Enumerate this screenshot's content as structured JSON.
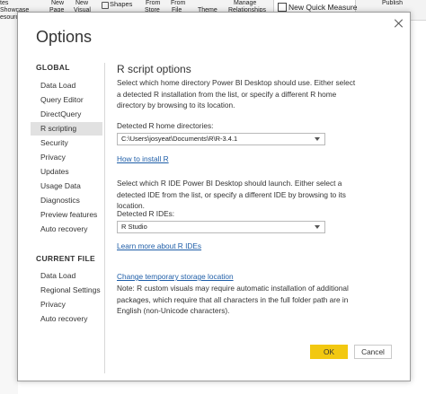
{
  "ribbon": {
    "items": [
      {
        "line1": "tes",
        "line2": "Showcase"
      },
      {
        "line1": "",
        "line2": ""
      },
      {
        "line1": "New",
        "line2": "Page"
      },
      {
        "line1": "New",
        "line2": "Visual"
      },
      {
        "shapes": "Shapes"
      },
      {
        "line1": "From",
        "line2": "Store"
      },
      {
        "line1": "From",
        "line2": "File"
      },
      {
        "line1": "",
        "line2": "Theme"
      },
      {
        "line1": "Manage",
        "line2": "Relationships"
      }
    ],
    "new_quick_measure": "New Quick Measure",
    "publish": "Publish",
    "resources_fragment": "esourc"
  },
  "dialog": {
    "title": "Options",
    "nav": {
      "global_header": "GLOBAL",
      "global_items": [
        "Data Load",
        "Query Editor",
        "DirectQuery",
        "R scripting",
        "Security",
        "Privacy",
        "Updates",
        "Usage Data",
        "Diagnostics",
        "Preview features",
        "Auto recovery"
      ],
      "selected": "R scripting",
      "current_file_header": "CURRENT FILE",
      "current_file_items": [
        "Data Load",
        "Regional Settings",
        "Privacy",
        "Auto recovery"
      ]
    },
    "content": {
      "heading": "R script options",
      "home_desc": "Select which home directory Power BI Desktop should use. Either select a detected R installation from the list, or specify a different R home directory by browsing to its location.",
      "home_label": "Detected R home directories:",
      "home_value": "C:\\Users\\josyeat\\Documents\\R\\R-3.4.1",
      "install_link": "How to install R",
      "ide_desc": "Select which R IDE Power BI Desktop should launch. Either select a detected IDE from the list, or specify a different IDE by browsing to its location.",
      "ide_label": "Detected R IDEs:",
      "ide_value": "R Studio",
      "ide_link": "Learn more about R IDEs",
      "storage_link": "Change temporary storage location",
      "note": "Note: R custom visuals may require automatic installation of additional packages, which require that all characters in the full folder path are in English (non-Unicode characters)."
    },
    "buttons": {
      "ok": "OK",
      "cancel": "Cancel"
    }
  }
}
